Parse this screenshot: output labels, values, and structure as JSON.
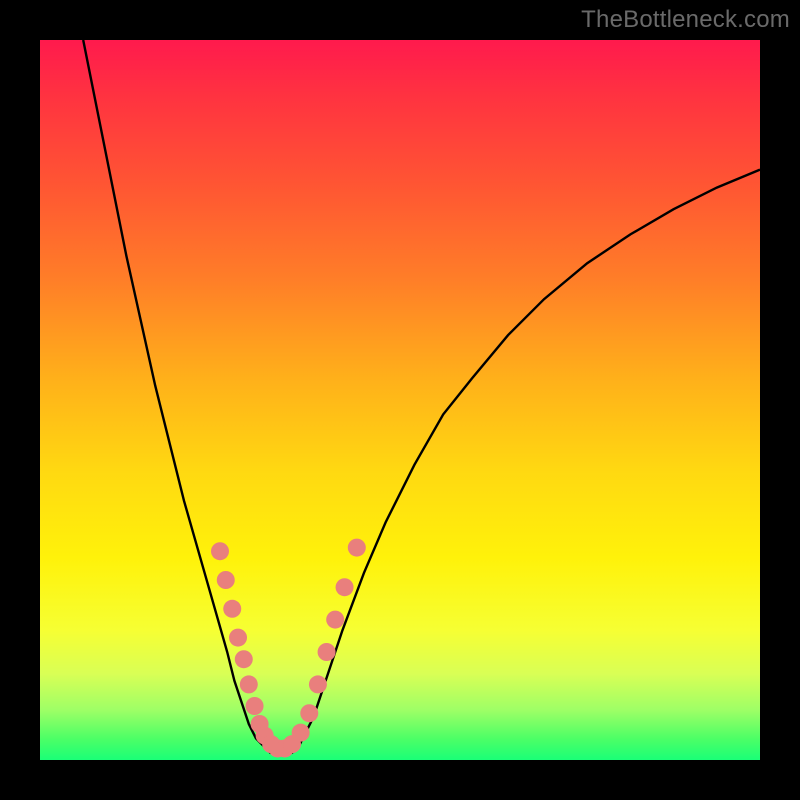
{
  "watermark": "TheBottleneck.com",
  "chart_data": {
    "type": "line",
    "title": "",
    "xlabel": "",
    "ylabel": "",
    "xlim": [
      0,
      100
    ],
    "ylim": [
      0,
      100
    ],
    "series": [
      {
        "name": "left-curve",
        "x": [
          6,
          8,
          10,
          12,
          14,
          16,
          18,
          20,
          22,
          24,
          26,
          27,
          28,
          29,
          30,
          31
        ],
        "y": [
          100,
          90,
          80,
          70,
          61,
          52,
          44,
          36,
          29,
          22,
          15,
          11,
          8,
          5,
          3,
          2
        ]
      },
      {
        "name": "valley-floor",
        "x": [
          31,
          32,
          33,
          34,
          35,
          36
        ],
        "y": [
          2,
          1,
          0.8,
          0.8,
          1,
          2
        ]
      },
      {
        "name": "right-curve",
        "x": [
          36,
          38,
          40,
          42,
          45,
          48,
          52,
          56,
          60,
          65,
          70,
          76,
          82,
          88,
          94,
          100
        ],
        "y": [
          2,
          6,
          12,
          18,
          26,
          33,
          41,
          48,
          53,
          59,
          64,
          69,
          73,
          76.5,
          79.5,
          82
        ]
      }
    ],
    "markers": {
      "name": "highlighted-points",
      "color": "#e97f7d",
      "radius_px": 9,
      "points": [
        {
          "x": 25.0,
          "y": 29
        },
        {
          "x": 25.8,
          "y": 25
        },
        {
          "x": 26.7,
          "y": 21
        },
        {
          "x": 27.5,
          "y": 17
        },
        {
          "x": 28.3,
          "y": 14
        },
        {
          "x": 29.0,
          "y": 10.5
        },
        {
          "x": 29.8,
          "y": 7.5
        },
        {
          "x": 30.5,
          "y": 5
        },
        {
          "x": 31.2,
          "y": 3.4
        },
        {
          "x": 32.1,
          "y": 2.2
        },
        {
          "x": 33.0,
          "y": 1.6
        },
        {
          "x": 34.0,
          "y": 1.6
        },
        {
          "x": 35.0,
          "y": 2.2
        },
        {
          "x": 36.2,
          "y": 3.8
        },
        {
          "x": 37.4,
          "y": 6.5
        },
        {
          "x": 38.6,
          "y": 10.5
        },
        {
          "x": 39.8,
          "y": 15
        },
        {
          "x": 41.0,
          "y": 19.5
        },
        {
          "x": 42.3,
          "y": 24
        },
        {
          "x": 44.0,
          "y": 29.5
        }
      ]
    }
  }
}
